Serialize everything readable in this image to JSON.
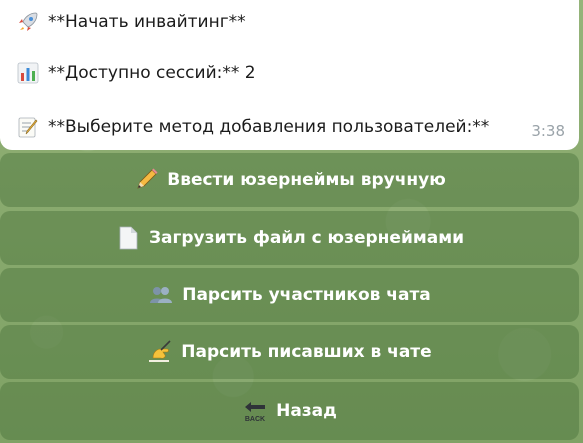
{
  "message": {
    "line1": {
      "icon": "rocket-icon",
      "text": "**Начать инвайтинг**"
    },
    "line2": {
      "icon": "bar-chart-icon",
      "text": "**Доступно сессий:** 2"
    },
    "line3": {
      "icon": "memo-icon",
      "text": "**Выберите метод добавления пользователей:**"
    },
    "time": "3:38"
  },
  "keyboard": {
    "buttons": [
      {
        "icon": "pencil-icon",
        "label": "Ввести юзернеймы вручную"
      },
      {
        "icon": "page-icon",
        "label": "Загрузить файл с юзернеймами"
      },
      {
        "icon": "users-icon",
        "label": "Парсить участников чата"
      },
      {
        "icon": "writing-hand-icon",
        "label": "Парсить писавших в чате"
      },
      {
        "icon": "back-arrow-icon",
        "label": "Назад"
      }
    ]
  },
  "colors": {
    "bubble": "#ffffff",
    "button_bg": "#6f955a",
    "button_text": "#ffffff",
    "timestamp": "#9aa3a9"
  }
}
